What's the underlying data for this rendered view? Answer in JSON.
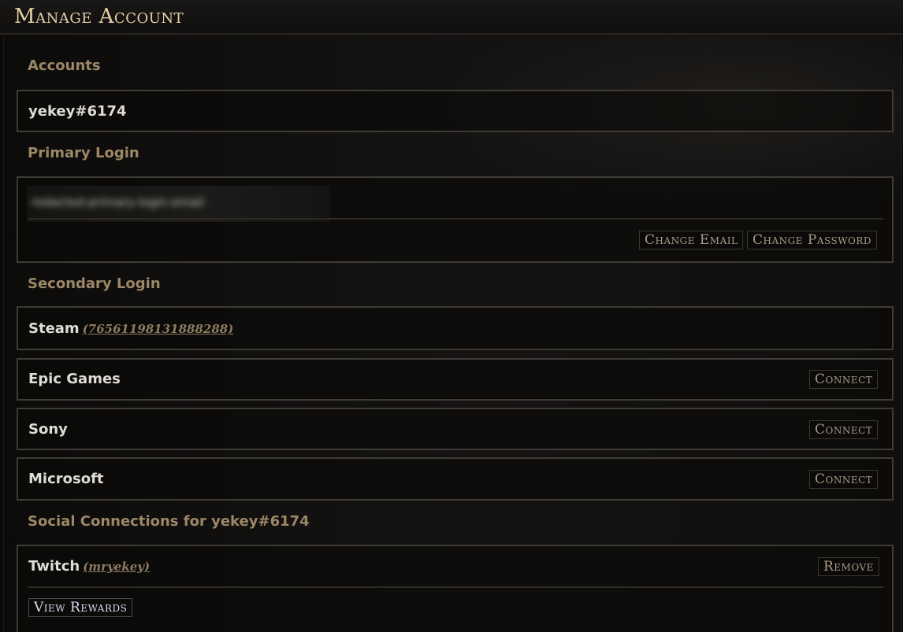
{
  "header": {
    "title": "Manage Account"
  },
  "accounts": {
    "label": "Accounts",
    "name": "yekey#6174"
  },
  "primary_login": {
    "label": "Primary Login",
    "change_email": "Change Email",
    "change_password": "Change Password"
  },
  "secondary_login": {
    "label": "Secondary Login",
    "steam": {
      "name": "Steam",
      "id": "(76561198131888288)"
    },
    "epic": {
      "name": "Epic Games",
      "action": "Connect"
    },
    "sony": {
      "name": "Sony",
      "action": "Connect"
    },
    "microsoft": {
      "name": "Microsoft",
      "action": "Connect"
    }
  },
  "social": {
    "label": "Social Connections for yekey#6174",
    "twitch": {
      "name": "Twitch",
      "handle": "(mryekey)",
      "remove": "Remove",
      "rewards": "View Rewards"
    }
  },
  "colors": {
    "label": "#9c8767",
    "title": "#e5cfa7",
    "border": "#3f3b36",
    "link": "#8d7c60"
  }
}
